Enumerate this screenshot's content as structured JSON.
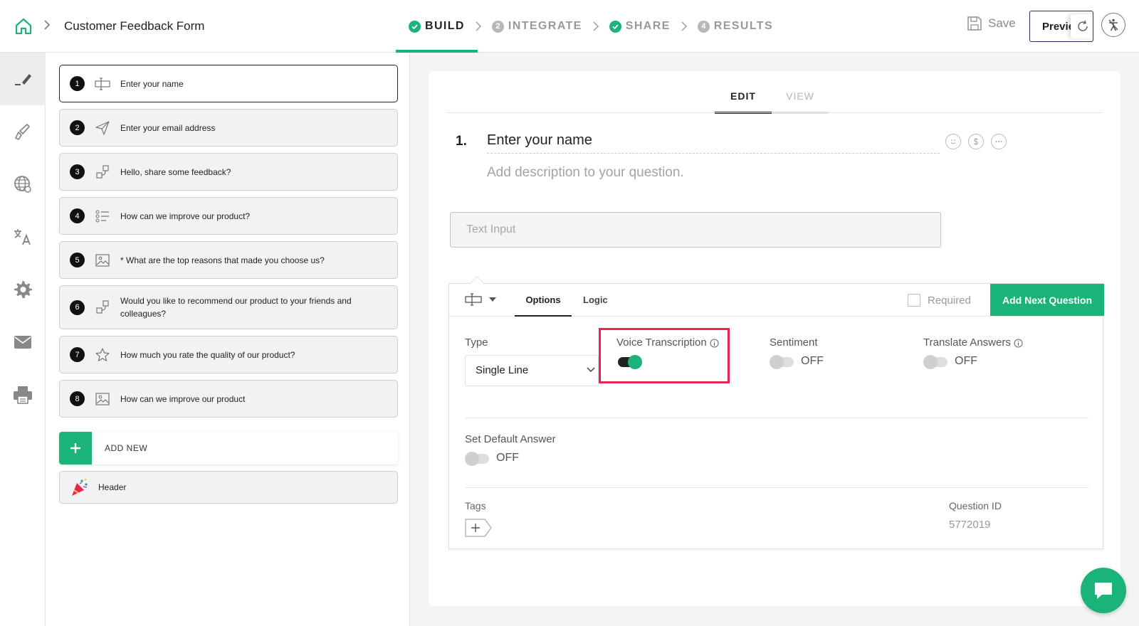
{
  "header": {
    "form_title": "Customer Feedback Form",
    "steps": [
      {
        "label": "BUILD",
        "marker": "check",
        "state": "active"
      },
      {
        "label": "INTEGRATE",
        "marker": "2",
        "state": "pending"
      },
      {
        "label": "SHARE",
        "marker": "check",
        "state": "done"
      },
      {
        "label": "RESULTS",
        "marker": "4",
        "state": "pending"
      }
    ],
    "save_label": "Save",
    "preview_label": "Preview"
  },
  "rail": {
    "items": [
      "edit-icon",
      "brush-icon",
      "globe-icon",
      "translate-icon",
      "settings-icon",
      "mail-icon",
      "print-icon"
    ],
    "active": "edit-icon"
  },
  "questions": [
    {
      "num": "1",
      "text": "Enter your name",
      "icon": "text-field-icon"
    },
    {
      "num": "2",
      "text": "Enter your email address",
      "icon": "send-icon"
    },
    {
      "num": "3",
      "text": "Hello, share some feedback?",
      "icon": "matrix-icon"
    },
    {
      "num": "4",
      "text": "How can we improve our product?",
      "icon": "list-icon"
    },
    {
      "num": "5",
      "text": "* What are the top reasons that made you choose us?",
      "icon": "image-icon"
    },
    {
      "num": "6",
      "text": "Would you like to recommend our product to your friends and colleagues?",
      "icon": "matrix-icon"
    },
    {
      "num": "7",
      "text": "How much you rate the quality of our product?",
      "icon": "star-icon"
    },
    {
      "num": "8",
      "text": "How can we improve our product",
      "icon": "image-icon"
    }
  ],
  "add_new_label": "ADD NEW",
  "header_item_label": "Header",
  "editor": {
    "tabs": {
      "edit": "EDIT",
      "view": "VIEW"
    },
    "question_number": "1.",
    "question_title": "Enter your name",
    "description_placeholder": "Add description to your question.",
    "answer_placeholder": "Text Input",
    "options_tab": "Options",
    "logic_tab": "Logic",
    "required_label": "Required",
    "add_next_label": "Add Next Question",
    "type_label": "Type",
    "type_value": "Single Line",
    "voice_label": "Voice Transcription",
    "voice_on": true,
    "sentiment_label": "Sentiment",
    "sentiment_state": "OFF",
    "translate_label": "Translate Answers",
    "translate_state": "OFF",
    "default_answer_label": "Set Default Answer",
    "default_answer_state": "OFF",
    "tags_label": "Tags",
    "question_id_label": "Question ID",
    "question_id": "5772019"
  },
  "colors": {
    "accent": "#1ab37a",
    "highlight": "#e8244f",
    "dark": "#222222"
  }
}
